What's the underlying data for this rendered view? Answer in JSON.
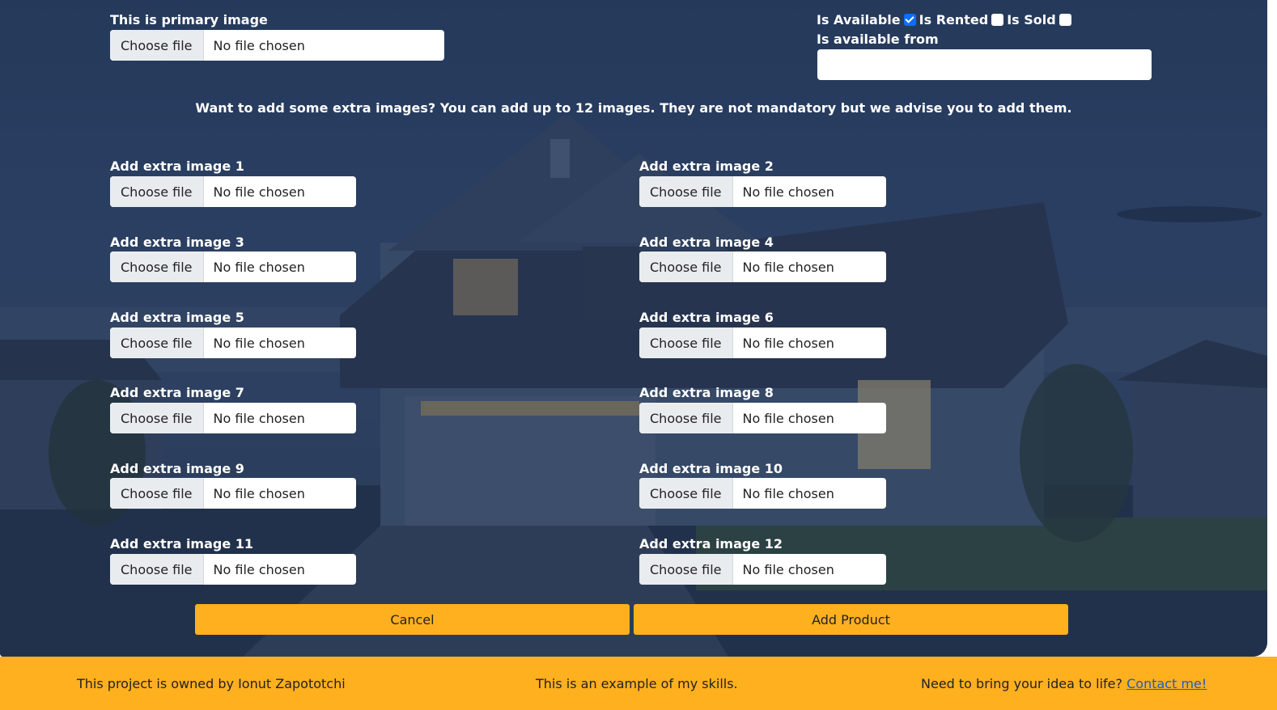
{
  "primary": {
    "label": "This is primary image",
    "button": "Choose file",
    "status": "No file chosen"
  },
  "flags": {
    "available_label": "Is Available",
    "available_checked": true,
    "rented_label": "Is Rented",
    "rented_checked": false,
    "sold_label": "Is Sold",
    "sold_checked": false,
    "available_from_label": "Is available from",
    "available_from_value": ""
  },
  "extra_info": "Want to add some extra images? You can add up to 12 images. They are not mandatory but we advise you to add them.",
  "extra": {
    "button": "Choose file",
    "status": "No file chosen",
    "labels": [
      "Add extra image 1",
      "Add extra image 2",
      "Add extra image 3",
      "Add extra image 4",
      "Add extra image 5",
      "Add extra image 6",
      "Add extra image 7",
      "Add extra image 8",
      "Add extra image 9",
      "Add extra image 10",
      "Add extra image 11",
      "Add extra image 12"
    ]
  },
  "actions": {
    "cancel": "Cancel",
    "add": "Add Product"
  },
  "footer": {
    "owner": "This project is owned by Ionut Zapototchi",
    "example": "This is an example of my skills.",
    "cta": "Need to bring your idea to life?",
    "contact": "Contact me!"
  },
  "colors": {
    "accent": "#ffb01f",
    "link": "#1e5bc6",
    "checkbox": "#0d6efd"
  }
}
